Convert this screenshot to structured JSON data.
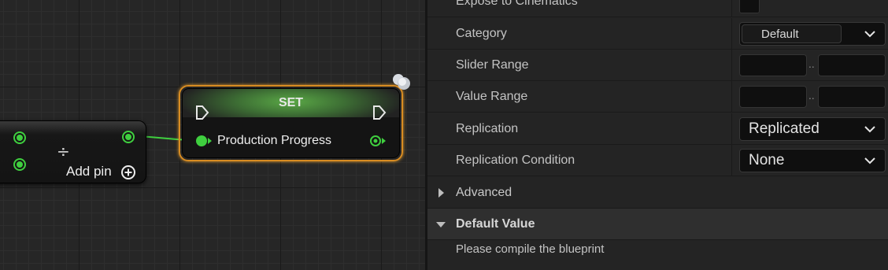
{
  "graph": {
    "math_node": {
      "add_pin_label": "Add pin",
      "operator_icon": "divide-icon",
      "add_icon": "plus-circle-icon"
    },
    "set_node": {
      "title": "SET",
      "variable_label": "Production Progress",
      "header_color": "#5aa846",
      "selection_color": "#d88c22",
      "pin_color": "#3fcf3f"
    }
  },
  "details": {
    "rows": {
      "expose_to_cinematics": {
        "label": "Expose to Cinematics"
      },
      "category": {
        "label": "Category",
        "value": "Default"
      },
      "slider_range": {
        "label": "Slider Range",
        "separator": ".."
      },
      "value_range": {
        "label": "Value Range",
        "separator": ".."
      },
      "replication": {
        "label": "Replication",
        "value": "Replicated"
      },
      "replication_condition": {
        "label": "Replication Condition",
        "value": "None"
      }
    },
    "sections": {
      "advanced": {
        "label": "Advanced",
        "expanded": false
      },
      "default_value": {
        "label": "Default Value",
        "expanded": true
      }
    },
    "message": "Please compile the blueprint"
  }
}
